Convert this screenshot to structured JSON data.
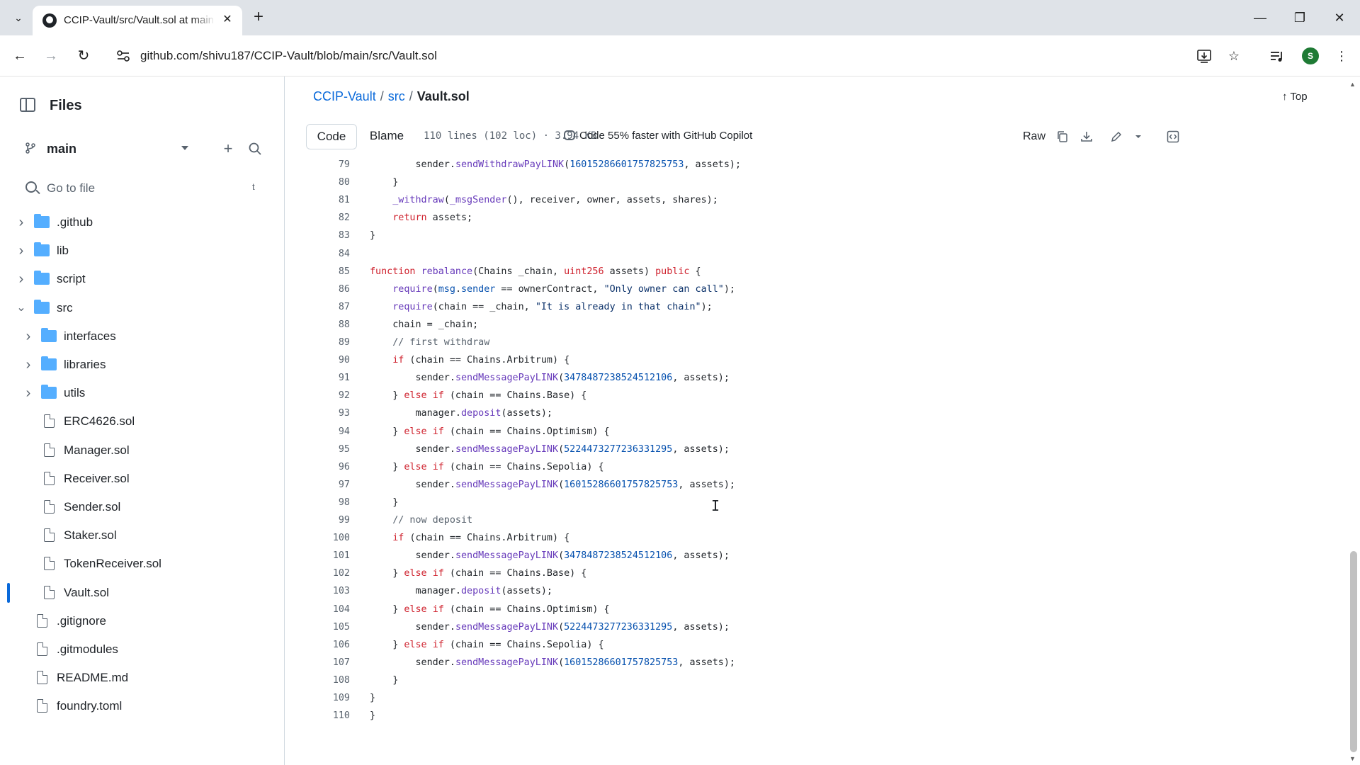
{
  "browser": {
    "tab_title": "CCIP-Vault/src/Vault.sol at main",
    "url": "github.com/shivu187/CCIP-Vault/blob/main/src/Vault.sol",
    "profile_initial": "S"
  },
  "sidebar": {
    "title": "Files",
    "branch": "main",
    "search_placeholder": "Go to file",
    "search_shortcut": "t",
    "tree": [
      {
        "label": ".github",
        "type": "folder",
        "depth": 0,
        "expanded": false
      },
      {
        "label": "lib",
        "type": "folder",
        "depth": 0,
        "expanded": false
      },
      {
        "label": "script",
        "type": "folder",
        "depth": 0,
        "expanded": false
      },
      {
        "label": "src",
        "type": "folder",
        "depth": 0,
        "expanded": true
      },
      {
        "label": "interfaces",
        "type": "folder",
        "depth": 1,
        "expanded": false
      },
      {
        "label": "libraries",
        "type": "folder",
        "depth": 1,
        "expanded": false
      },
      {
        "label": "utils",
        "type": "folder",
        "depth": 1,
        "expanded": false
      },
      {
        "label": "ERC4626.sol",
        "type": "file",
        "depth": 1
      },
      {
        "label": "Manager.sol",
        "type": "file",
        "depth": 1
      },
      {
        "label": "Receiver.sol",
        "type": "file",
        "depth": 1
      },
      {
        "label": "Sender.sol",
        "type": "file",
        "depth": 1
      },
      {
        "label": "Staker.sol",
        "type": "file",
        "depth": 1
      },
      {
        "label": "TokenReceiver.sol",
        "type": "file",
        "depth": 1
      },
      {
        "label": "Vault.sol",
        "type": "file",
        "depth": 1,
        "selected": true
      },
      {
        "label": ".gitignore",
        "type": "file",
        "depth": 0
      },
      {
        "label": ".gitmodules",
        "type": "file",
        "depth": 0
      },
      {
        "label": "README.md",
        "type": "file",
        "depth": 0
      },
      {
        "label": "foundry.toml",
        "type": "file",
        "depth": 0
      }
    ]
  },
  "main": {
    "breadcrumb": {
      "repo": "CCIP-Vault",
      "dir": "src",
      "file": "Vault.sol"
    },
    "top_label": "Top",
    "tabs": {
      "code": "Code",
      "blame": "Blame"
    },
    "file_meta": "110 lines (102 loc) · 3.94 KB",
    "copilot": "Code 55% faster with GitHub Copilot",
    "raw_label": "Raw"
  },
  "code_lines": [
    {
      "n": "79",
      "tokens": [
        [
          "        sender.",
          ""
        ],
        [
          "sendWithdrawPayLINK",
          "fn"
        ],
        [
          "(",
          ""
        ],
        [
          "16015286601757825753",
          "num"
        ],
        [
          ", assets);",
          ""
        ]
      ]
    },
    {
      "n": "80",
      "tokens": [
        [
          "    }",
          ""
        ]
      ]
    },
    {
      "n": "81",
      "tokens": [
        [
          "    ",
          ""
        ],
        [
          "_withdraw",
          "fn"
        ],
        [
          "(",
          ""
        ],
        [
          "_msgSender",
          "fn"
        ],
        [
          "(), receiver, owner, assets, shares);",
          ""
        ]
      ]
    },
    {
      "n": "82",
      "tokens": [
        [
          "    ",
          ""
        ],
        [
          "return",
          "kw"
        ],
        [
          " assets;",
          ""
        ]
      ]
    },
    {
      "n": "83",
      "tokens": [
        [
          "}",
          ""
        ]
      ]
    },
    {
      "n": "84",
      "tokens": [
        [
          "",
          ""
        ]
      ]
    },
    {
      "n": "85",
      "tokens": [
        [
          "function",
          "kw"
        ],
        [
          " ",
          ""
        ],
        [
          "rebalance",
          "fn"
        ],
        [
          "(Chains _chain, ",
          ""
        ],
        [
          "uint256",
          "kw"
        ],
        [
          " assets) ",
          ""
        ],
        [
          "public",
          "kw"
        ],
        [
          " {",
          ""
        ]
      ]
    },
    {
      "n": "86",
      "tokens": [
        [
          "    ",
          ""
        ],
        [
          "require",
          "fn"
        ],
        [
          "(",
          ""
        ],
        [
          "msg",
          "num"
        ],
        [
          ".",
          ""
        ],
        [
          "sender",
          "num"
        ],
        [
          " == ownerContract, ",
          ""
        ],
        [
          "\"Only owner can call\"",
          "str"
        ],
        [
          ");",
          ""
        ]
      ]
    },
    {
      "n": "87",
      "tokens": [
        [
          "    ",
          ""
        ],
        [
          "require",
          "fn"
        ],
        [
          "(chain == _chain, ",
          ""
        ],
        [
          "\"It is already in that chain\"",
          "str"
        ],
        [
          ");",
          ""
        ]
      ]
    },
    {
      "n": "88",
      "tokens": [
        [
          "    chain = _chain;",
          ""
        ]
      ]
    },
    {
      "n": "89",
      "tokens": [
        [
          "    ",
          ""
        ],
        [
          "// first withdraw",
          "cm"
        ]
      ]
    },
    {
      "n": "90",
      "tokens": [
        [
          "    ",
          ""
        ],
        [
          "if",
          "kw"
        ],
        [
          " (chain == Chains.Arbitrum) {",
          ""
        ]
      ]
    },
    {
      "n": "91",
      "tokens": [
        [
          "        sender.",
          ""
        ],
        [
          "sendMessagePayLINK",
          "fn"
        ],
        [
          "(",
          ""
        ],
        [
          "3478487238524512106",
          "num"
        ],
        [
          ", assets);",
          ""
        ]
      ]
    },
    {
      "n": "92",
      "tokens": [
        [
          "    } ",
          ""
        ],
        [
          "else",
          "kw"
        ],
        [
          " ",
          ""
        ],
        [
          "if",
          "kw"
        ],
        [
          " (chain == Chains.Base) {",
          ""
        ]
      ]
    },
    {
      "n": "93",
      "tokens": [
        [
          "        manager.",
          ""
        ],
        [
          "deposit",
          "fn"
        ],
        [
          "(assets);",
          ""
        ]
      ]
    },
    {
      "n": "94",
      "tokens": [
        [
          "    } ",
          ""
        ],
        [
          "else",
          "kw"
        ],
        [
          " ",
          ""
        ],
        [
          "if",
          "kw"
        ],
        [
          " (chain == Chains.Optimism) {",
          ""
        ]
      ]
    },
    {
      "n": "95",
      "tokens": [
        [
          "        sender.",
          ""
        ],
        [
          "sendMessagePayLINK",
          "fn"
        ],
        [
          "(",
          ""
        ],
        [
          "5224473277236331295",
          "num"
        ],
        [
          ", assets);",
          ""
        ]
      ]
    },
    {
      "n": "96",
      "tokens": [
        [
          "    } ",
          ""
        ],
        [
          "else",
          "kw"
        ],
        [
          " ",
          ""
        ],
        [
          "if",
          "kw"
        ],
        [
          " (chain == Chains.Sepolia) {",
          ""
        ]
      ]
    },
    {
      "n": "97",
      "tokens": [
        [
          "        sender.",
          ""
        ],
        [
          "sendMessagePayLINK",
          "fn"
        ],
        [
          "(",
          ""
        ],
        [
          "16015286601757825753",
          "num"
        ],
        [
          ", assets);",
          ""
        ]
      ]
    },
    {
      "n": "98",
      "tokens": [
        [
          "    }",
          ""
        ]
      ]
    },
    {
      "n": "99",
      "tokens": [
        [
          "    ",
          ""
        ],
        [
          "// now deposit",
          "cm"
        ]
      ]
    },
    {
      "n": "100",
      "tokens": [
        [
          "    ",
          ""
        ],
        [
          "if",
          "kw"
        ],
        [
          " (chain == Chains.Arbitrum) {",
          ""
        ]
      ]
    },
    {
      "n": "101",
      "tokens": [
        [
          "        sender.",
          ""
        ],
        [
          "sendMessagePayLINK",
          "fn"
        ],
        [
          "(",
          ""
        ],
        [
          "3478487238524512106",
          "num"
        ],
        [
          ", assets);",
          ""
        ]
      ]
    },
    {
      "n": "102",
      "tokens": [
        [
          "    } ",
          ""
        ],
        [
          "else",
          "kw"
        ],
        [
          " ",
          ""
        ],
        [
          "if",
          "kw"
        ],
        [
          " (chain == Chains.Base) {",
          ""
        ]
      ]
    },
    {
      "n": "103",
      "tokens": [
        [
          "        manager.",
          ""
        ],
        [
          "deposit",
          "fn"
        ],
        [
          "(assets);",
          ""
        ]
      ]
    },
    {
      "n": "104",
      "tokens": [
        [
          "    } ",
          ""
        ],
        [
          "else",
          "kw"
        ],
        [
          " ",
          ""
        ],
        [
          "if",
          "kw"
        ],
        [
          " (chain == Chains.Optimism) {",
          ""
        ]
      ]
    },
    {
      "n": "105",
      "tokens": [
        [
          "        sender.",
          ""
        ],
        [
          "sendMessagePayLINK",
          "fn"
        ],
        [
          "(",
          ""
        ],
        [
          "5224473277236331295",
          "num"
        ],
        [
          ", assets);",
          ""
        ]
      ]
    },
    {
      "n": "106",
      "tokens": [
        [
          "    } ",
          ""
        ],
        [
          "else",
          "kw"
        ],
        [
          " ",
          ""
        ],
        [
          "if",
          "kw"
        ],
        [
          " (chain == Chains.Sepolia) {",
          ""
        ]
      ]
    },
    {
      "n": "107",
      "tokens": [
        [
          "        sender.",
          ""
        ],
        [
          "sendMessagePayLINK",
          "fn"
        ],
        [
          "(",
          ""
        ],
        [
          "16015286601757825753",
          "num"
        ],
        [
          ", assets);",
          ""
        ]
      ]
    },
    {
      "n": "108",
      "tokens": [
        [
          "    }",
          ""
        ]
      ]
    },
    {
      "n": "109",
      "tokens": [
        [
          "}",
          ""
        ]
      ]
    },
    {
      "n": "110",
      "tokens": [
        [
          "}",
          ""
        ]
      ]
    }
  ],
  "icons": {
    "tab_menu": "chevron-down-icon",
    "favicon": "github-icon",
    "install": "install-app-icon",
    "bookmark": "star-icon",
    "media": "media-control-icon",
    "menu": "kebab-menu-icon",
    "copy": "copy-icon",
    "download": "download-icon",
    "edit": "pencil-icon",
    "symbols": "symbols-panel-icon"
  },
  "colors": {
    "accent": "#0969da",
    "folder": "#54aeff",
    "keyword": "#cf222e",
    "function": "#6639ba",
    "number": "#0550ae",
    "string": "#0a3069"
  }
}
